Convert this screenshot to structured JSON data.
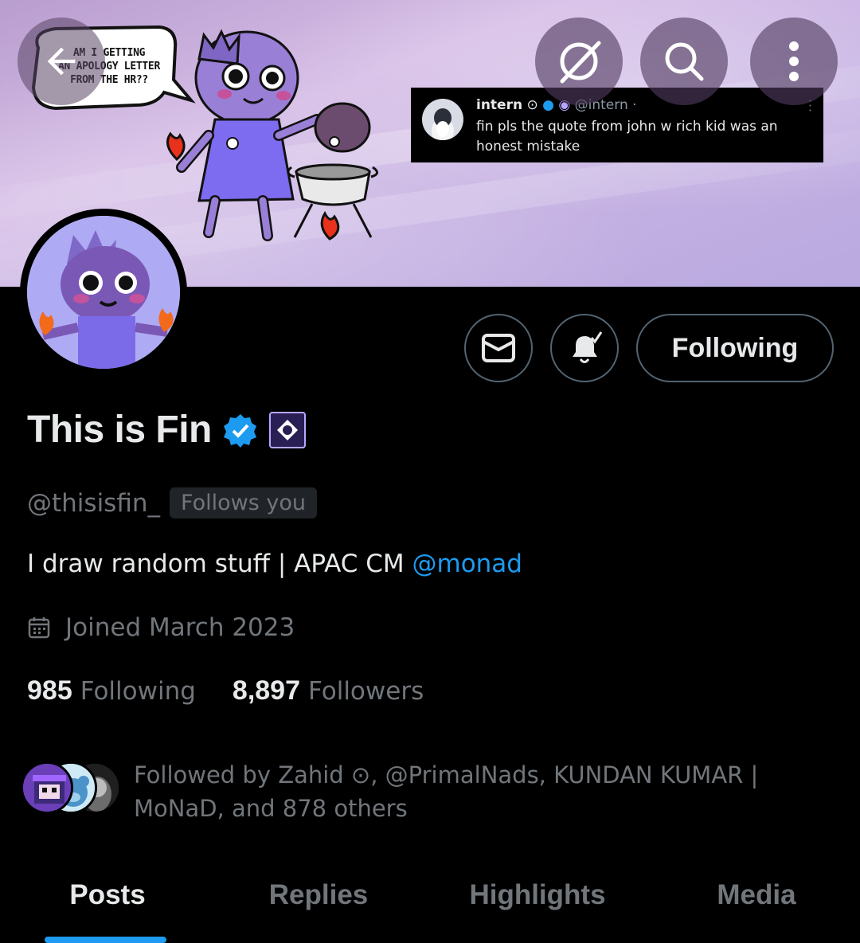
{
  "banner": {
    "speech_bubble": [
      "AM I GETTING",
      "AN APOLOGY LETTER",
      "FROM THE HR??"
    ],
    "quote": {
      "name": "intern",
      "handle": "@intern",
      "separator": "·",
      "text": "fin pls the quote from john w rich kid was an honest mistake"
    }
  },
  "top_bar": {
    "back_icon": "arrow-left-icon",
    "grok_icon": "grok-icon",
    "search_icon": "search-icon",
    "more_icon": "more-vertical-icon"
  },
  "actions": {
    "message_icon": "envelope-icon",
    "notify_icon": "bell-check-icon",
    "following_label": "Following"
  },
  "profile": {
    "display_name": "This is Fin",
    "handle": "@thisisfin_",
    "follows_you": "Follows you",
    "bio_text": "I draw random stuff | APAC CM ",
    "bio_mention": "@monad",
    "joined": "Joined March 2023",
    "following_count": "985",
    "following_label": "Following",
    "followers_count": "8,897",
    "followers_label": "Followers",
    "followed_by_line1": "Followed by Zahid ⊙, @PrimalNads, KUNDAN KUMAR |",
    "followed_by_line2": "MoNaD, and 878 others"
  },
  "tabs": [
    {
      "label": "Posts",
      "active": true
    },
    {
      "label": "Replies",
      "active": false
    },
    {
      "label": "Highlights",
      "active": false
    },
    {
      "label": "Media",
      "active": false
    }
  ],
  "colors": {
    "accent": "#1d9bf0",
    "muted": "#71767b",
    "text": "#e7e9ea",
    "background": "#000000"
  }
}
